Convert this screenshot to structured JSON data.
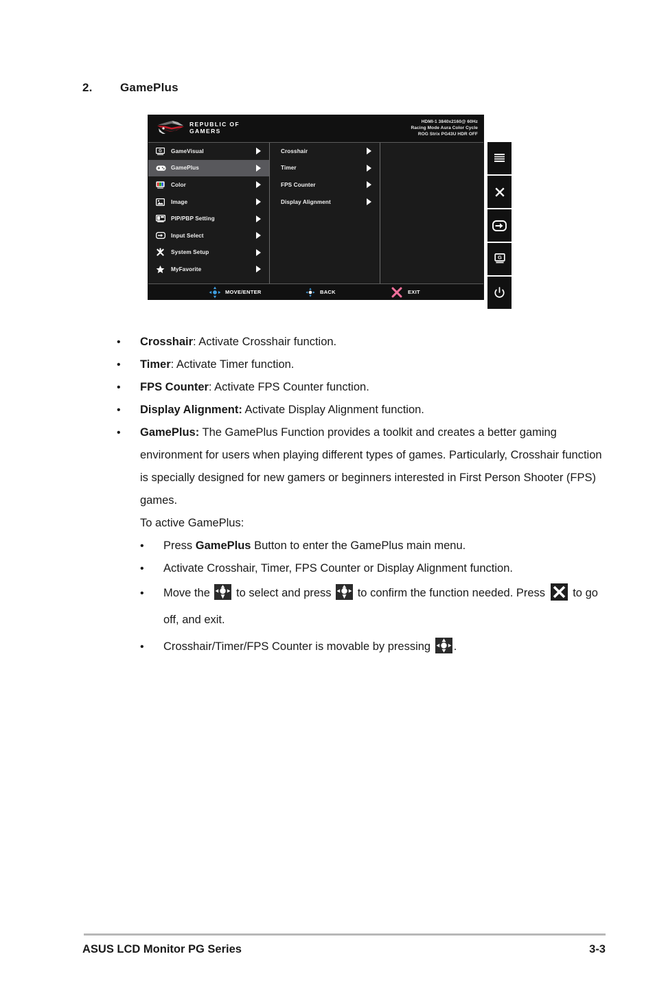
{
  "page": {
    "heading_number": "2.",
    "heading_title": "GamePlus",
    "footer_left": "ASUS LCD Monitor PG Series",
    "footer_right": "3-3"
  },
  "osd": {
    "brand_line1": "REPUBLIC OF",
    "brand_line2": "GAMERS",
    "logo_icon": "rog-logo-icon",
    "info": {
      "line1": "HDMI-1 3840x2160@ 60Hz",
      "line2": "Racing Mode Aura Color Cycle",
      "line3": "ROG Strix PG43U HDR OFF"
    },
    "colors": {
      "panel_bg": "#1b1b1b",
      "header_bg": "#111111",
      "selected_row": "#58585c",
      "divider": "#6a6a6a",
      "joystick_blue": "#3e9ee0",
      "exit_pink": "#f0709b",
      "text": "#f0f0f0"
    },
    "main_menu": [
      {
        "label": "GameVisual",
        "icon": "gamevisual-icon",
        "selected": false
      },
      {
        "label": "GamePlus",
        "icon": "gameplus-icon",
        "selected": true
      },
      {
        "label": "Color",
        "icon": "color-icon",
        "selected": false
      },
      {
        "label": "Image",
        "icon": "image-icon",
        "selected": false
      },
      {
        "label": "PIP/PBP Setting",
        "icon": "pip-pbp-icon",
        "selected": false
      },
      {
        "label": "Input Select",
        "icon": "input-select-icon",
        "selected": false
      },
      {
        "label": "System Setup",
        "icon": "system-setup-icon",
        "selected": false
      },
      {
        "label": "MyFavorite",
        "icon": "myfavorite-icon",
        "selected": false
      }
    ],
    "sub_menu": [
      {
        "label": "Crosshair"
      },
      {
        "label": "Timer"
      },
      {
        "label": "FPS Counter"
      },
      {
        "label": "Display Alignment"
      }
    ],
    "hints": [
      {
        "label": "MOVE/ENTER",
        "icon": "joystick-icon"
      },
      {
        "label": "BACK",
        "icon": "joystick-icon"
      },
      {
        "label": "EXIT",
        "icon": "close-x-icon"
      }
    ],
    "hw_buttons": [
      {
        "name": "menu-button",
        "icon": "hamburger-menu-icon"
      },
      {
        "name": "close-button",
        "icon": "close-x-icon"
      },
      {
        "name": "input-select-button",
        "icon": "input-arrow-icon"
      },
      {
        "name": "gamevisual-button",
        "icon": "gamevisual-g-icon"
      },
      {
        "name": "power-button",
        "icon": "power-icon"
      }
    ]
  },
  "content": {
    "b1_term": "Crosshair",
    "b1_rest": ": Activate Crosshair function.",
    "b2_term": "Timer",
    "b2_rest": ": Activate Timer function.",
    "b3_term": "FPS Counter",
    "b3_rest": ": Activate FPS Counter function.",
    "b4_term": "Display Alignment:",
    "b4_rest": " Activate Display Alignment function.",
    "b5_term": "GamePlus:",
    "b5_rest": " The GamePlus Function provides a toolkit and creates a better gaming environment for users when playing different types of games. Particularly, Crosshair function is specially designed for new gamers or beginners interested in First Person Shooter (FPS) games.",
    "b5_tail": "To active GamePlus:",
    "s1_pre": "Press ",
    "s1_bold": "GamePlus",
    "s1_post": " Button to enter the GamePlus main menu.",
    "s2": "Activate Crosshair, Timer, FPS Counter or Display Alignment function.",
    "s3_a": "Move the ",
    "s3_b": " to select and press ",
    "s3_c": " to confirm the function needed. Press ",
    "s3_d": " to go off, and exit.",
    "s4_a": "Crosshair/Timer/FPS Counter is movable by pressing ",
    "s4_b": ".",
    "bullet": "•"
  }
}
